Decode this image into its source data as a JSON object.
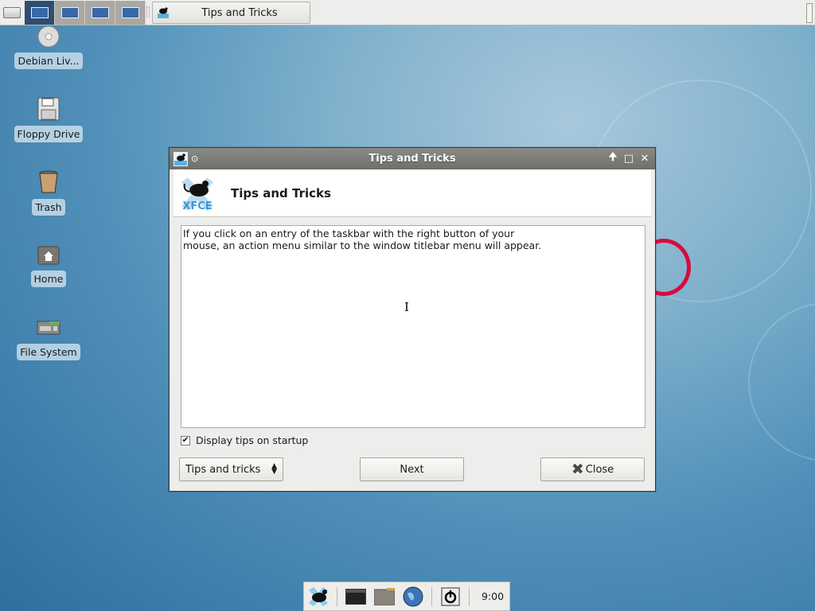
{
  "top_panel": {
    "show_desktop_icon": "show-desktop-icon",
    "workspaces": [
      {
        "name": "Workspace 1",
        "active": true
      },
      {
        "name": "Workspace 2",
        "active": false
      },
      {
        "name": "Workspace 3",
        "active": false
      },
      {
        "name": "Workspace 4",
        "active": false
      }
    ],
    "tasks": [
      {
        "label": "Tips and Tricks",
        "icon": "xfce-mouse-icon"
      }
    ]
  },
  "desktop": {
    "icons": [
      {
        "label": "Debian Liv...",
        "icon": "cdrom-icon"
      },
      {
        "label": "Floppy Drive",
        "icon": "floppy-icon"
      },
      {
        "label": "Trash",
        "icon": "trash-icon"
      },
      {
        "label": "Home",
        "icon": "home-folder-icon"
      },
      {
        "label": "File System",
        "icon": "drive-icon"
      }
    ]
  },
  "dialog": {
    "title": "Tips and Tricks",
    "header_title": "Tips and Tricks",
    "tip_text": "If you click on an entry of the taskbar with the right button of your\nmouse, an action menu similar to the window titlebar menu will appear.",
    "checkbox_label": "Display tips on startup",
    "checkbox_checked": true,
    "combo_value": "Tips and tricks",
    "next_label": "Next",
    "close_label": "Close",
    "titlebar_buttons": [
      "shade",
      "maximize",
      "close"
    ]
  },
  "bottom_panel": {
    "launchers": [
      "xfce-menu-icon",
      "terminal-icon",
      "file-manager-icon",
      "web-browser-icon",
      "logout-icon"
    ],
    "clock": "9:00"
  },
  "colors": {
    "accent": "#2c4d75",
    "titlebar": "#7b7b77",
    "debian_red": "#d70a3c"
  }
}
